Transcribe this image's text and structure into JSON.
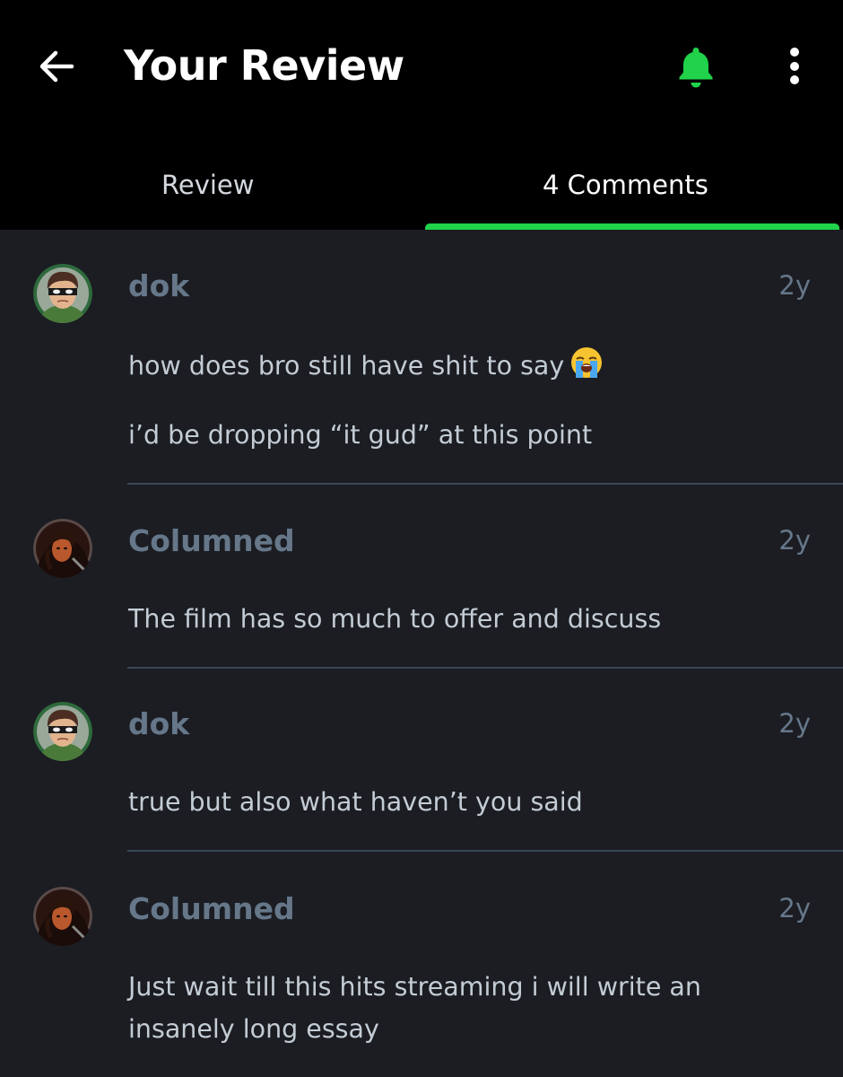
{
  "header": {
    "title": "Your Review",
    "back_icon": "arrow-left-icon",
    "bell_icon": "bell-icon",
    "more_icon": "more-vertical-icon",
    "accent_color": "#20d34a"
  },
  "tabs": [
    {
      "label": "Review",
      "active": false
    },
    {
      "label": "4 Comments",
      "active": true
    }
  ],
  "comments": [
    {
      "author": "dok",
      "time": "2y",
      "avatar": "dok-avatar",
      "lines": [
        "how does bro still have shit to say",
        "i’d be dropping “it gud” at this point"
      ],
      "emoji": "loudly-crying-face-emoji"
    },
    {
      "author": "Columned",
      "time": "2y",
      "avatar": "columned-avatar",
      "lines": [
        "The film has so much to offer and discuss"
      ]
    },
    {
      "author": "dok",
      "time": "2y",
      "avatar": "dok-avatar",
      "lines": [
        "true but also what haven’t you said"
      ]
    },
    {
      "author": "Columned",
      "time": "2y",
      "avatar": "columned-avatar",
      "lines": [
        "Just wait till this hits streaming i will write an",
        "insanely long essay"
      ]
    }
  ]
}
